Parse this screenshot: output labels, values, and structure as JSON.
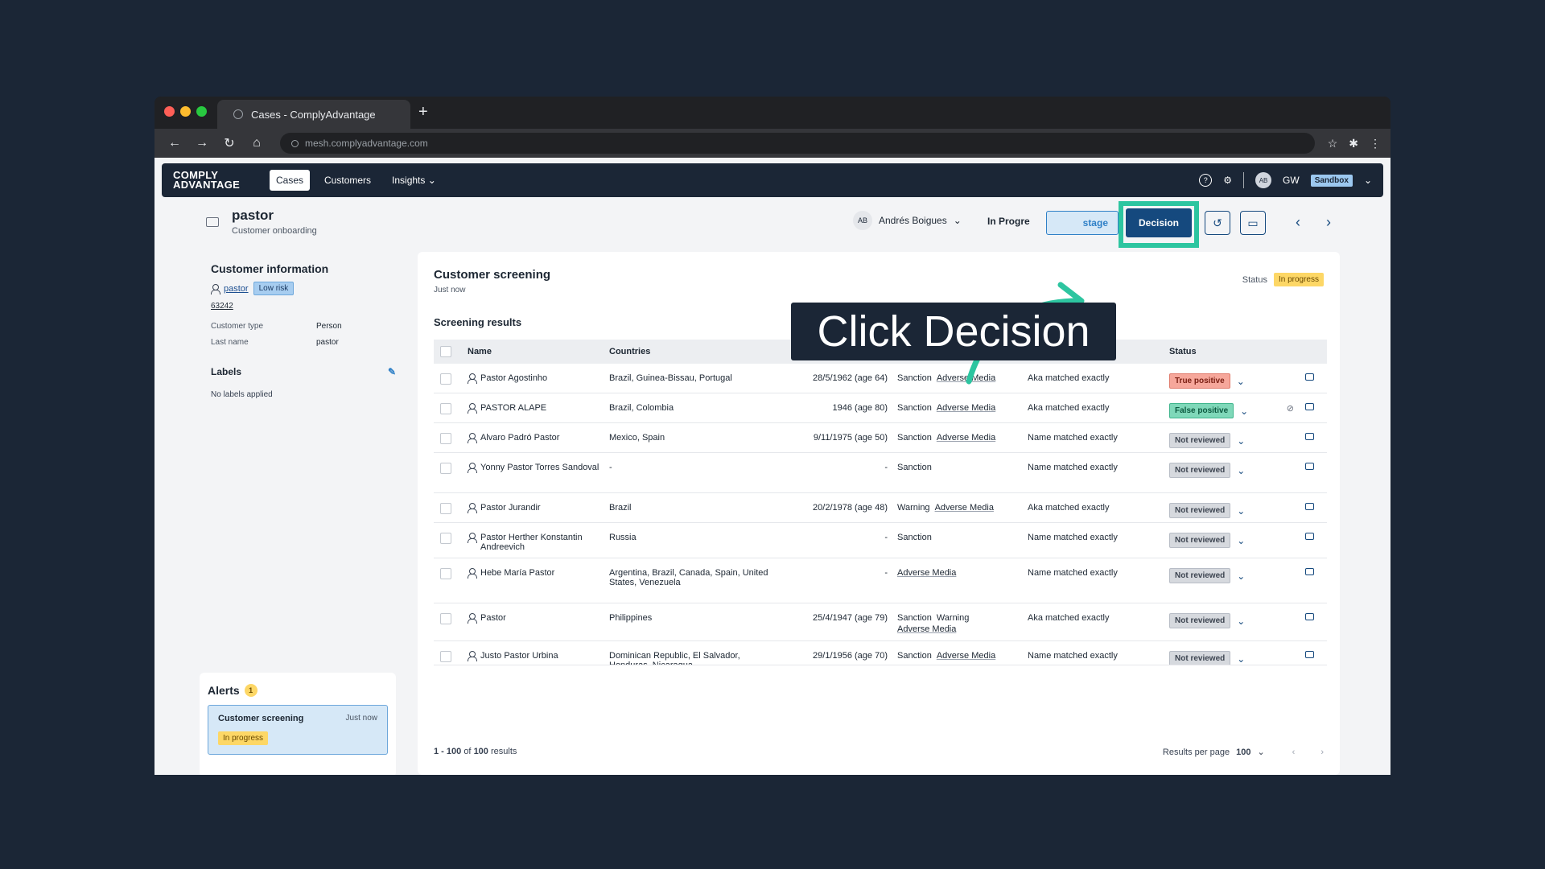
{
  "browser": {
    "tab_title": "Cases - ComplyAdvantage",
    "new_tab": "+",
    "url": "mesh.complyadvantage.com"
  },
  "nav": {
    "logo_line1": "COMPLY",
    "logo_line2": "ADVANTAGE",
    "items": [
      "Cases",
      "Customers",
      "Insights"
    ],
    "user_initials": "AB",
    "user_short": "GW",
    "env_badge": "Sandbox"
  },
  "case": {
    "title": "pastor",
    "subtitle": "Customer onboarding",
    "assignee_initials": "AB",
    "assignee_name": "Andrés Boigues",
    "status_text": "In Progre",
    "stage_button": "stage",
    "decision_button": "Decision"
  },
  "customer_info": {
    "heading": "Customer information",
    "name_link": "pastor",
    "risk_badge": "Low risk",
    "customer_id": "63242",
    "customer_type_label": "Customer type",
    "customer_type_value": "Person",
    "last_name_label": "Last name",
    "last_name_value": "pastor",
    "labels_heading": "Labels",
    "no_labels": "No labels applied"
  },
  "alerts": {
    "heading": "Alerts",
    "count": "1",
    "item_title": "Customer screening",
    "item_time": "Just now",
    "item_status": "In progress"
  },
  "screening": {
    "title": "Customer screening",
    "subtitle": "Just now",
    "status_label": "Status",
    "status_value": "In progress",
    "results_heading": "Screening results",
    "columns": {
      "name": "Name",
      "countries": "Countries",
      "status": "Status"
    },
    "rows": [
      {
        "name": "Pastor Agostinho",
        "countries": "Brazil, Guinea-Bissau, Portugal",
        "dob": "28/5/1962 (age 64)",
        "types": [
          "Sanction",
          "Adverse Media"
        ],
        "match": "Aka matched exactly",
        "status": "True positive",
        "status_kind": "tp"
      },
      {
        "name": "PASTOR ALAPE",
        "countries": "Brazil, Colombia",
        "dob": "1946 (age 80)",
        "types": [
          "Sanction",
          "Adverse Media"
        ],
        "match": "Aka matched exactly",
        "status": "False positive",
        "status_kind": "fp"
      },
      {
        "name": "Alvaro Padró Pastor",
        "countries": "Mexico, Spain",
        "dob": "9/11/1975 (age 50)",
        "types": [
          "Sanction",
          "Adverse Media"
        ],
        "match": "Name matched exactly",
        "status": "Not reviewed",
        "status_kind": "nr"
      },
      {
        "name": "Yonny Pastor Torres Sandoval",
        "countries": "-",
        "dob": "-",
        "types": [
          "Sanction"
        ],
        "match": "Name matched exactly",
        "status": "Not reviewed",
        "status_kind": "nr"
      },
      {
        "name": "Pastor Jurandir",
        "countries": "Brazil",
        "dob": "20/2/1978 (age 48)",
        "types": [
          "Warning",
          "Adverse Media"
        ],
        "match": "Aka matched exactly",
        "status": "Not reviewed",
        "status_kind": "nr"
      },
      {
        "name": "Pastor Herther Konstantin Andreevich",
        "countries": "Russia",
        "dob": "-",
        "types": [
          "Sanction"
        ],
        "match": "Name matched exactly",
        "status": "Not reviewed",
        "status_kind": "nr"
      },
      {
        "name": "Hebe María Pastor",
        "countries": "Argentina, Brazil, Canada, Spain, United States, Venezuela",
        "dob": "-",
        "types": [
          "Adverse Media"
        ],
        "match": "Name matched exactly",
        "status": "Not reviewed",
        "status_kind": "nr"
      },
      {
        "name": "Pastor",
        "countries": "Philippines",
        "dob": "25/4/1947 (age 79)",
        "types": [
          "Sanction",
          "Warning",
          "Adverse Media"
        ],
        "match": "Aka matched exactly",
        "status": "Not reviewed",
        "status_kind": "nr"
      },
      {
        "name": "Justo Pastor Urbina",
        "countries": "Dominican Republic, El Salvador, Honduras, Nicaragua",
        "dob": "29/1/1956 (age 70)",
        "types": [
          "Sanction",
          "Adverse Media"
        ],
        "match": "Name matched exactly",
        "status": "Not reviewed",
        "status_kind": "nr"
      }
    ],
    "pager_range": "1 - 100",
    "pager_of": "of",
    "pager_total": "100",
    "pager_suffix": "results",
    "per_page_label": "Results per page",
    "per_page_value": "100"
  },
  "tutorial": {
    "callout": "Click Decision",
    "highlight_color": "#2dc5a0"
  }
}
